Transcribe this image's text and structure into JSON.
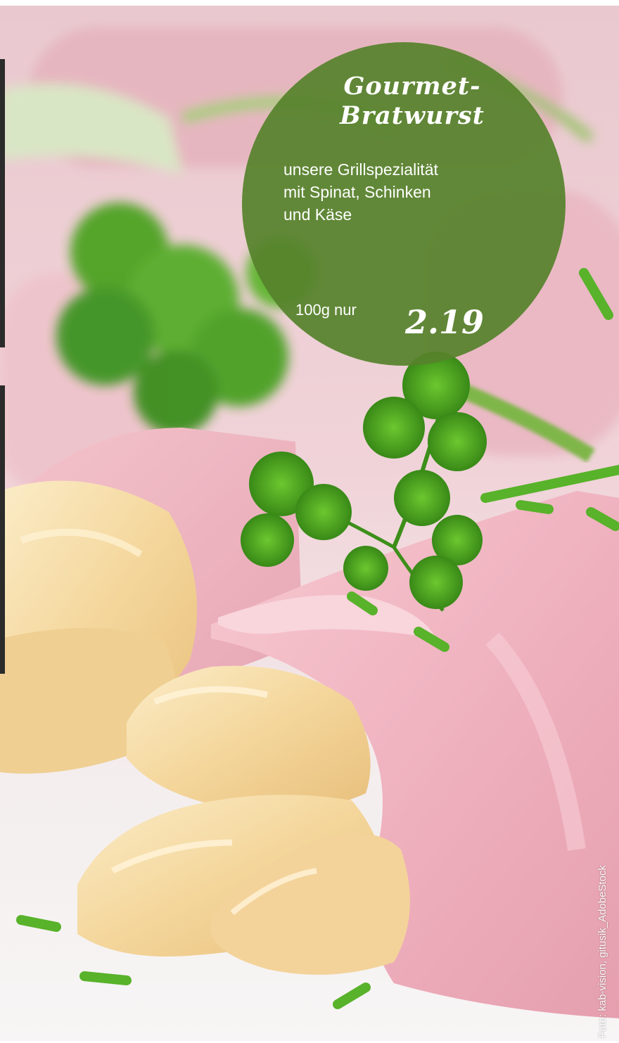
{
  "offer": {
    "title_line1": "Gourmet-",
    "title_line2": "Bratwurst",
    "description_lines": [
      "unsere Grillspezialität",
      "mit Spinat, Schinken",
      "und Käse"
    ],
    "unit_label": "100g nur",
    "price": "2.19"
  },
  "photo": {
    "subject": "ham-rolls-with-white-asparagus-and-parsley",
    "credit": "Foto: kab-vision, gitusik_AdobeStock"
  },
  "colors": {
    "badge_green": "#56822c",
    "ham_pink": "#f2b9c4",
    "asparagus_cream": "#f3d9a0",
    "parsley_green": "#3f9a1c"
  }
}
